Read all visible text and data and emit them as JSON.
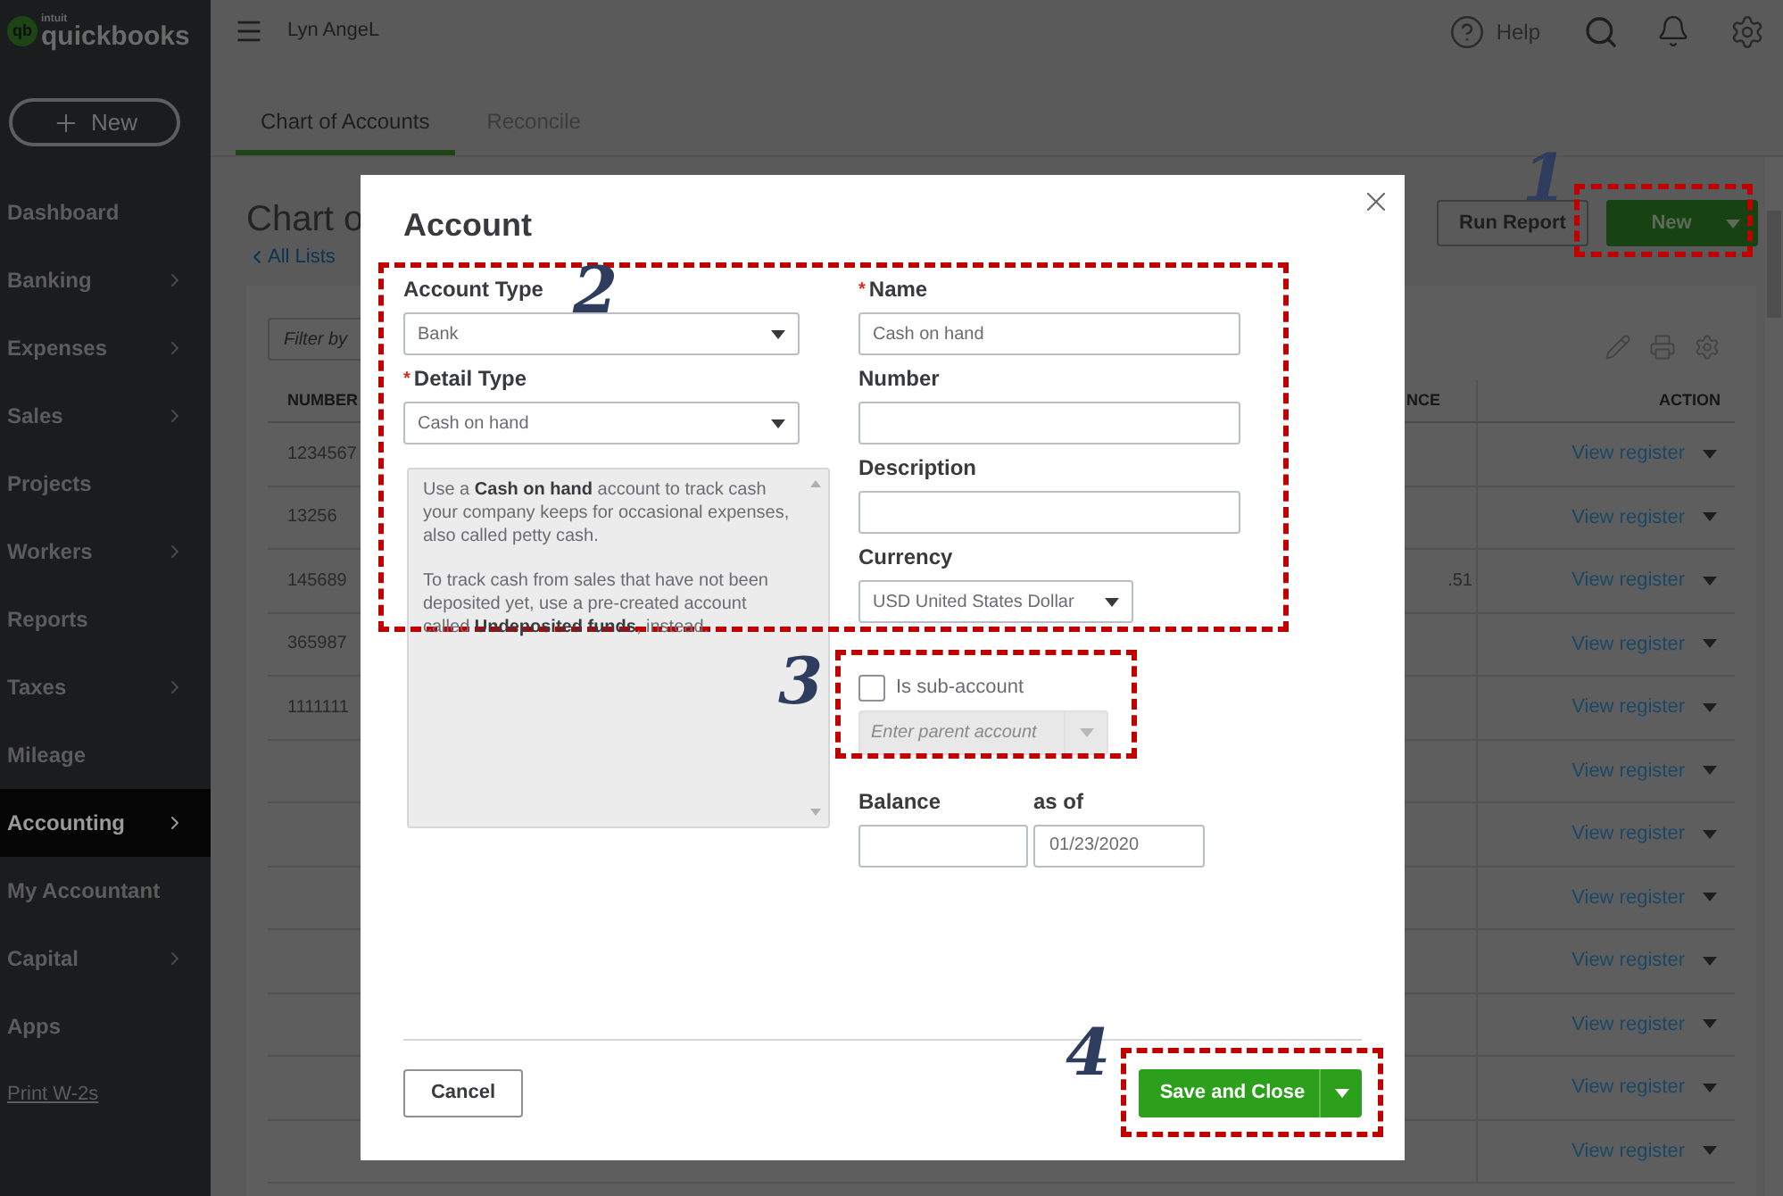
{
  "app": {
    "logo_mark": "qb",
    "logo_small": "intuit",
    "logo": "quickbooks",
    "new_button": "New"
  },
  "sidebar": {
    "items": [
      {
        "label": "Dashboard",
        "expandable": false,
        "selected": false
      },
      {
        "label": "Banking",
        "expandable": true,
        "selected": false
      },
      {
        "label": "Expenses",
        "expandable": true,
        "selected": false
      },
      {
        "label": "Sales",
        "expandable": true,
        "selected": false
      },
      {
        "label": "Projects",
        "expandable": false,
        "selected": false
      },
      {
        "label": "Workers",
        "expandable": true,
        "selected": false
      },
      {
        "label": "Reports",
        "expandable": false,
        "selected": false
      },
      {
        "label": "Taxes",
        "expandable": true,
        "selected": false
      },
      {
        "label": "Mileage",
        "expandable": false,
        "selected": false
      },
      {
        "label": "Accounting",
        "expandable": true,
        "selected": true
      },
      {
        "label": "My Accountant",
        "expandable": false,
        "selected": false
      },
      {
        "label": "Capital",
        "expandable": true,
        "selected": false
      },
      {
        "label": "Apps",
        "expandable": false,
        "selected": false
      }
    ],
    "link": "Print W-2s"
  },
  "topbar": {
    "company": "Lyn AngeL",
    "help": "Help"
  },
  "tabs": [
    {
      "label": "Chart of Accounts",
      "selected": true
    },
    {
      "label": "Reconcile",
      "selected": false
    }
  ],
  "page": {
    "title": "Chart o",
    "back_link": "All Lists",
    "run_report": "Run Report",
    "new": "New"
  },
  "table": {
    "filter_placeholder": "Filter by",
    "columns": [
      "NUMBER",
      "NCE",
      "ACTION"
    ],
    "rows": [
      {
        "number": "1234567",
        "action": "View register"
      },
      {
        "number": "13256",
        "action": "View register"
      },
      {
        "number": "145689",
        "balance": ".51",
        "action": "View register"
      },
      {
        "number": "365987",
        "action": "View register"
      },
      {
        "number": "1111111",
        "action": "View register"
      },
      {
        "action": "View register"
      },
      {
        "action": "View register"
      },
      {
        "action": "View register"
      },
      {
        "action": "View register"
      },
      {
        "action": "View register"
      },
      {
        "action": "View register"
      },
      {
        "action": "View register"
      }
    ]
  },
  "dialog": {
    "title": "Account",
    "required_mark": "*",
    "account_type": {
      "label": "Account Type",
      "value": "Bank",
      "required": false
    },
    "detail_type": {
      "label": "Detail Type",
      "value": "Cash on hand",
      "required": true
    },
    "help_text": [
      "Use a **Cash on hand** account to track cash your company keeps for occasional expenses, also called petty cash.",
      "To track cash from sales that have not been deposited yet, use a pre-created account called **Undeposited funds**, instead."
    ],
    "name": {
      "label": "Name",
      "value": "Cash on hand",
      "required": true
    },
    "number": {
      "label": "Number",
      "required": false
    },
    "description": {
      "label": "Description",
      "required": false
    },
    "currency": {
      "label": "Currency",
      "value": "USD United States Dollar"
    },
    "sub_account": {
      "label": "Is sub-account",
      "checked": false,
      "placeholder": "Enter parent account"
    },
    "balance": {
      "label": "Balance"
    },
    "as_of": {
      "label": "as of",
      "value": "01/23/2020"
    },
    "cancel": "Cancel",
    "save": "Save and Close"
  },
  "annotations": [
    {
      "label": "1"
    },
    {
      "label": "2"
    },
    {
      "label": "3"
    },
    {
      "label": "4"
    }
  ]
}
